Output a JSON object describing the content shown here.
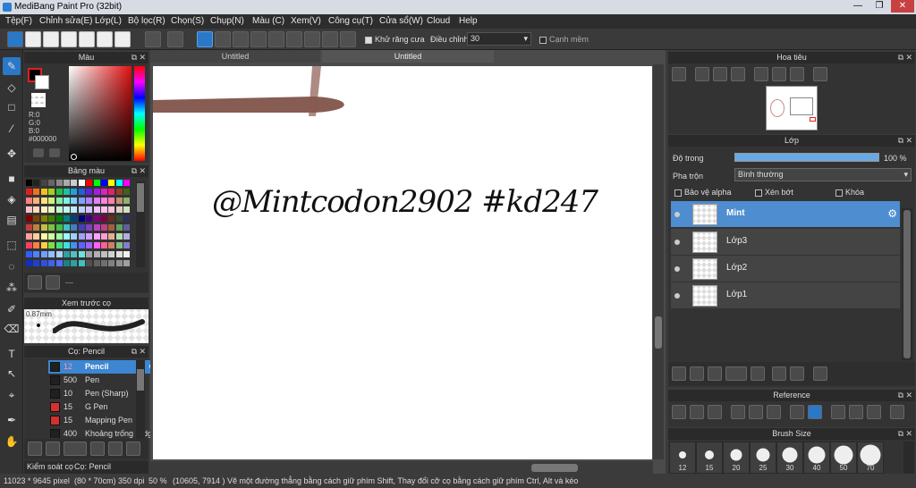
{
  "window": {
    "title": "MediBang Paint Pro (32bit)",
    "min": "—",
    "max": "❐",
    "close": "✕"
  },
  "menu": [
    "Tệp(F)",
    "Chỉnh sửa(E)",
    "Lớp(L)",
    "Bộ lọc(R)",
    "Chọn(S)",
    "Chụp(N)",
    "Màu (C)",
    "Xem(V)",
    "Công cụ(T)",
    "Cửa sổ(W)",
    "Cloud",
    "Help"
  ],
  "toolbar": {
    "antialias_label": "Khử răng cưa",
    "adjust_label": "Điều chỉnh",
    "adjust_value": "30",
    "edge_label": "Cạnh mềm"
  },
  "color_panel": {
    "title": "Màu",
    "r": "R:0",
    "g": "G:0",
    "b": "B:0",
    "hex": "#000000"
  },
  "palette_panel": {
    "title": "Bảng màu",
    "extra": "---"
  },
  "preview_panel": {
    "title": "Xem trước cọ",
    "size": "0.87mm"
  },
  "brush_panel": {
    "title": "Cọ: Pencil",
    "brushes": [
      {
        "size": "12",
        "name": "Pencil",
        "color": "#202020"
      },
      {
        "size": "500",
        "name": "Pen",
        "color": "#202020"
      },
      {
        "size": "10",
        "name": "Pen (Sharp)",
        "color": "#202020"
      },
      {
        "size": "15",
        "name": "G Pen",
        "color": "#d43030"
      },
      {
        "size": "15",
        "name": "Mapping Pen",
        "color": "#d43030"
      },
      {
        "size": "400",
        "name": "Khoảng trống [Edge",
        "color": "#202020"
      }
    ]
  },
  "bottom_tabs": [
    "Kiểm soát cọ",
    "Cọ: Pencil"
  ],
  "canvas_tabs": [
    "Untitled",
    "Untitled"
  ],
  "handwriting": "@Mintcodon2902 #kd247",
  "navigator_panel": {
    "title": "Hoa tiêu"
  },
  "layer_panel": {
    "title": "Lớp",
    "opacity_label": "Độ trong",
    "opacity_value": "100 %",
    "blend_label": "Pha trộn",
    "blend_value": "Bình thường",
    "protect_alpha": "Bảo vệ alpha",
    "clip": "Xén bớt",
    "lock": "Khóa",
    "layers": [
      "Mint",
      "Lớp3",
      "Lớp2",
      "Lớp1"
    ]
  },
  "reference_panel": {
    "title": "Reference"
  },
  "brushsize_panel": {
    "title": "Brush Size",
    "sizes": [
      "12",
      "15",
      "20",
      "25",
      "30",
      "40",
      "50",
      "70"
    ]
  },
  "status": {
    "dims": "11023 * 9645 pixel",
    "cm": "(80 * 70cm)",
    "dpi": "350 dpi",
    "zoom": "50 %",
    "coords": "(10605, 7914 )",
    "hint": "Vẽ một đường thẳng bằng cách giữ phím Shift, Thay đổi cỡ cọ bằng cách giữ phím Ctrl, Alt và kéo"
  }
}
